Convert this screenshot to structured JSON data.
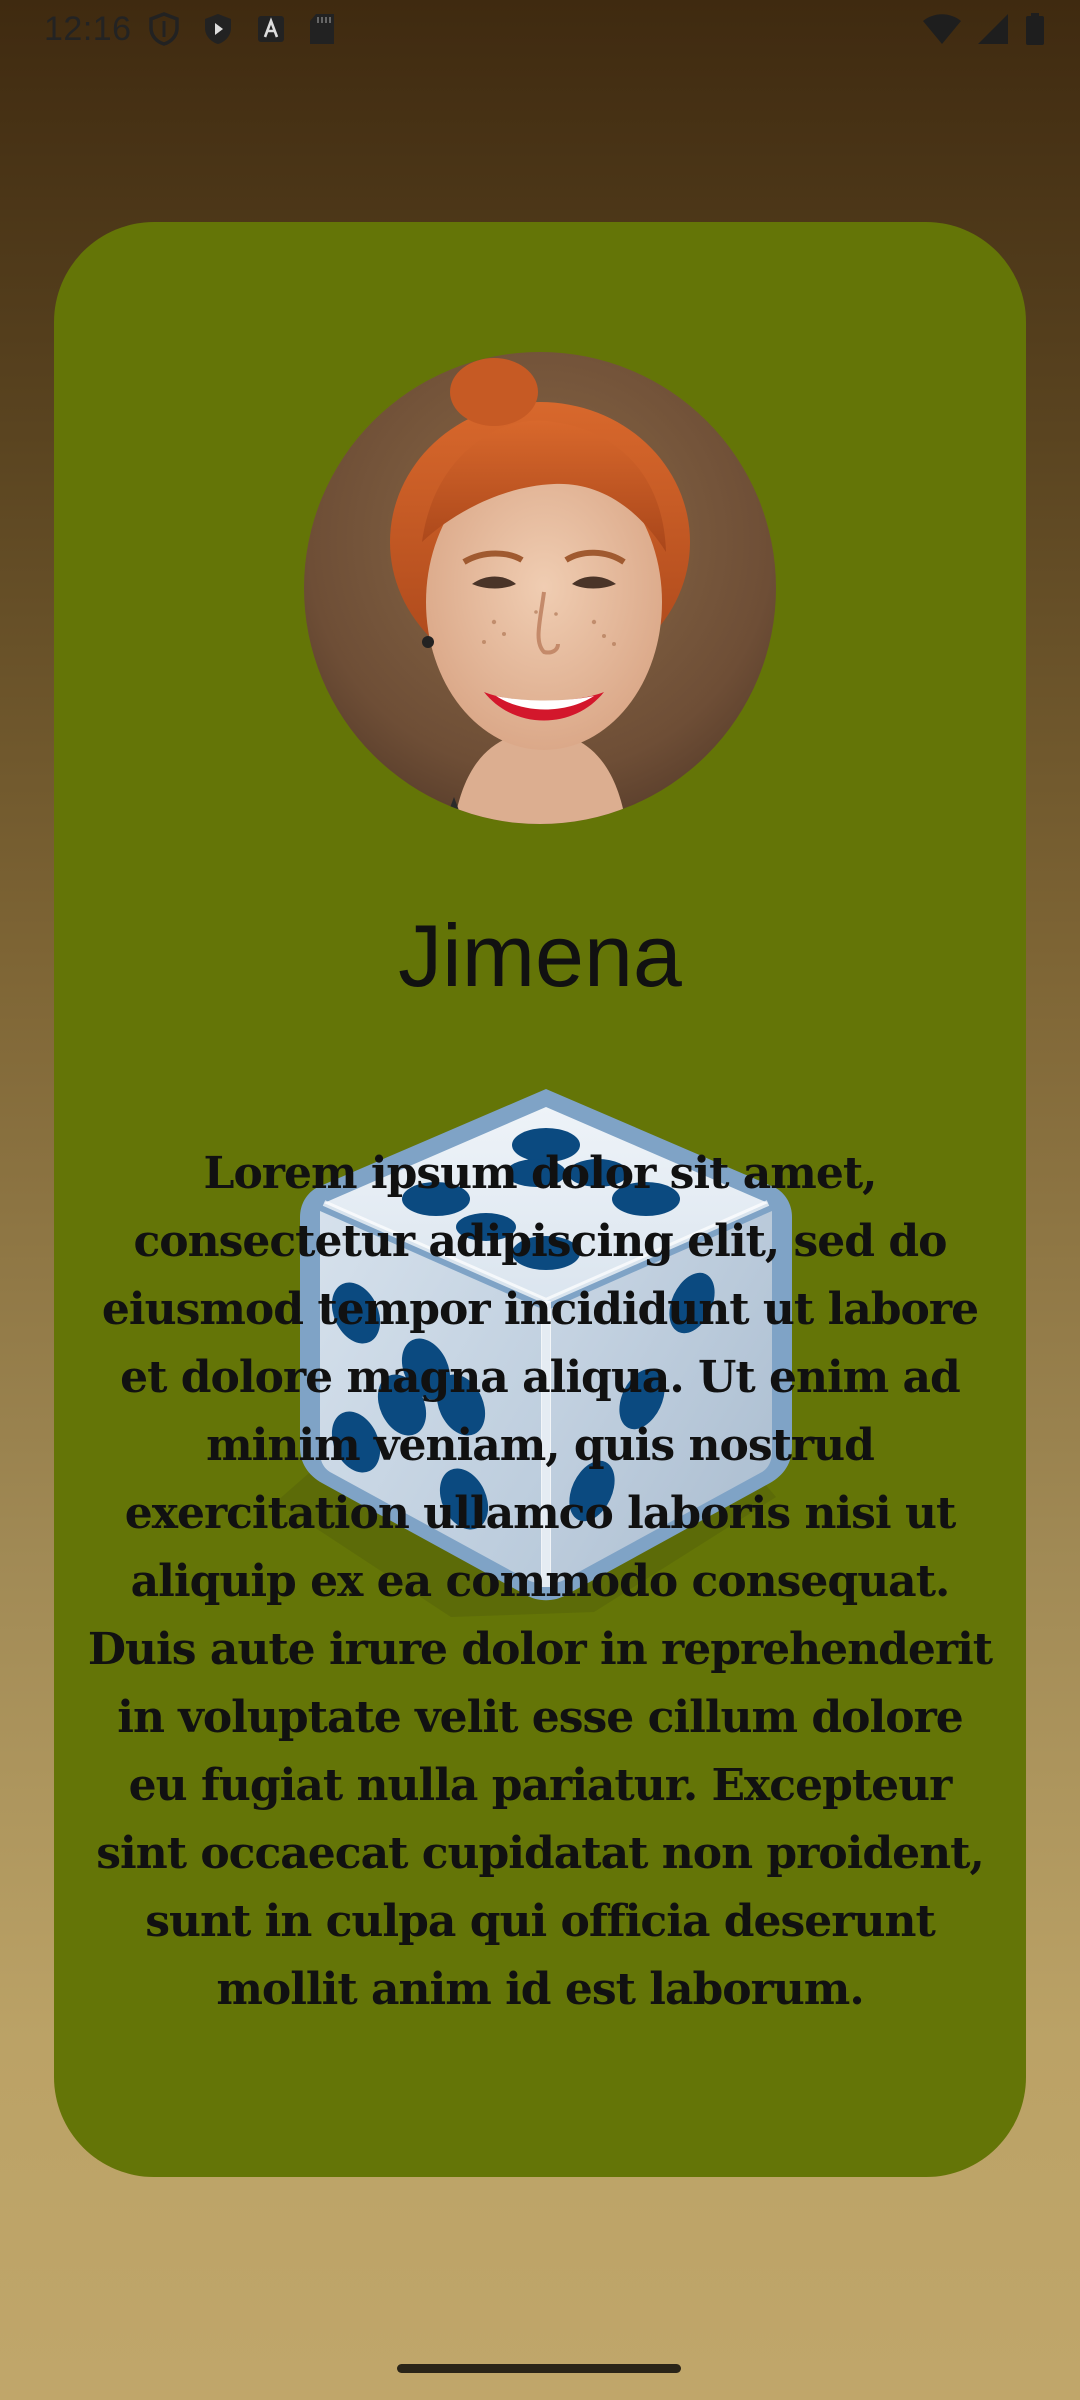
{
  "status_bar": {
    "time": "12:16",
    "left_icons": [
      "vpn-shield-icon",
      "shield-play-icon",
      "android-a-icon",
      "sd-card-icon"
    ],
    "right_icons": [
      "wifi-icon",
      "cell-signal-icon",
      "battery-icon"
    ]
  },
  "profile": {
    "name": "Jimena",
    "avatar": "avatar-photo",
    "description": "Lorem ipsum dolor sit amet, consectetur adipiscing elit, sed do eiusmod tempor incididunt ut labore et dolore magna aliqua. Ut enim ad minim veniam, quis nostrud exercitation ullamco laboris nisi ut aliquip ex ea commodo consequat. Duis aute irure dolor in reprehenderit in voluptate velit esse cillum dolore eu fugiat nulla pariatur. Excepteur sint occaecat cupidatat non proident, sunt in culpa qui officia deserunt mollit anim id est laborum."
  },
  "colors": {
    "card_background": "#647507",
    "text": "#111111",
    "dice_pip": "#0b4a80"
  }
}
